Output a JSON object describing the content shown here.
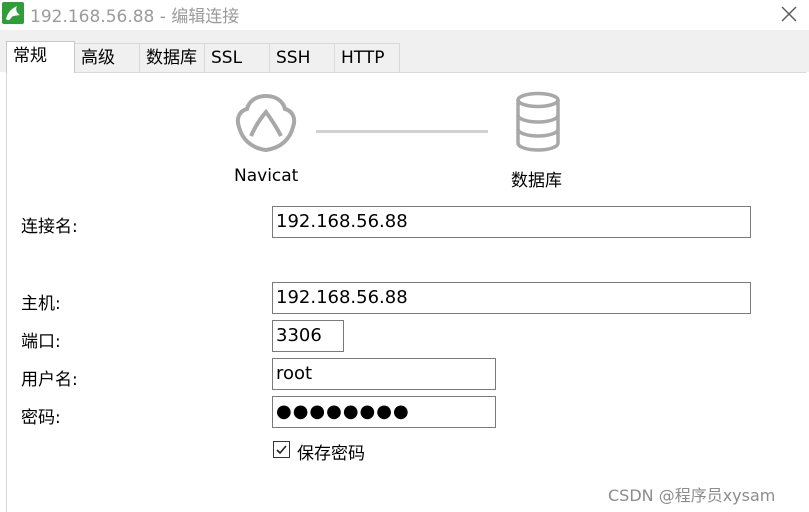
{
  "window": {
    "title": "192.168.56.88 - 编辑连接",
    "app_icon": "navicat-logo-icon",
    "close_icon": "close-icon"
  },
  "tabs": [
    {
      "label": "常规",
      "active": true
    },
    {
      "label": "高级",
      "active": false
    },
    {
      "label": "数据库",
      "active": false
    },
    {
      "label": "SSL",
      "active": false
    },
    {
      "label": "SSH",
      "active": false
    },
    {
      "label": "HTTP",
      "active": false
    }
  ],
  "diagram": {
    "left_label": "Navicat",
    "left_icon": "navicat-seal-icon",
    "right_label": "数据库",
    "right_icon": "database-icon"
  },
  "form": {
    "connection_name": {
      "label": "连接名:",
      "value": "192.168.56.88"
    },
    "host": {
      "label": "主机:",
      "value": "192.168.56.88"
    },
    "port": {
      "label": "端口:",
      "value": "3306"
    },
    "username": {
      "label": "用户名:",
      "value": "root"
    },
    "password": {
      "label": "密码:",
      "value": "●●●●●●●●"
    },
    "save_password": {
      "label": "保存密码",
      "checked": true
    }
  },
  "watermark": "CSDN @程序员xysam",
  "colors": {
    "logo_green": "#2e9d3a",
    "icon_gray": "#a8a8a8",
    "title_gray": "#9b9b9b",
    "field_border": "#7a7a7a"
  }
}
